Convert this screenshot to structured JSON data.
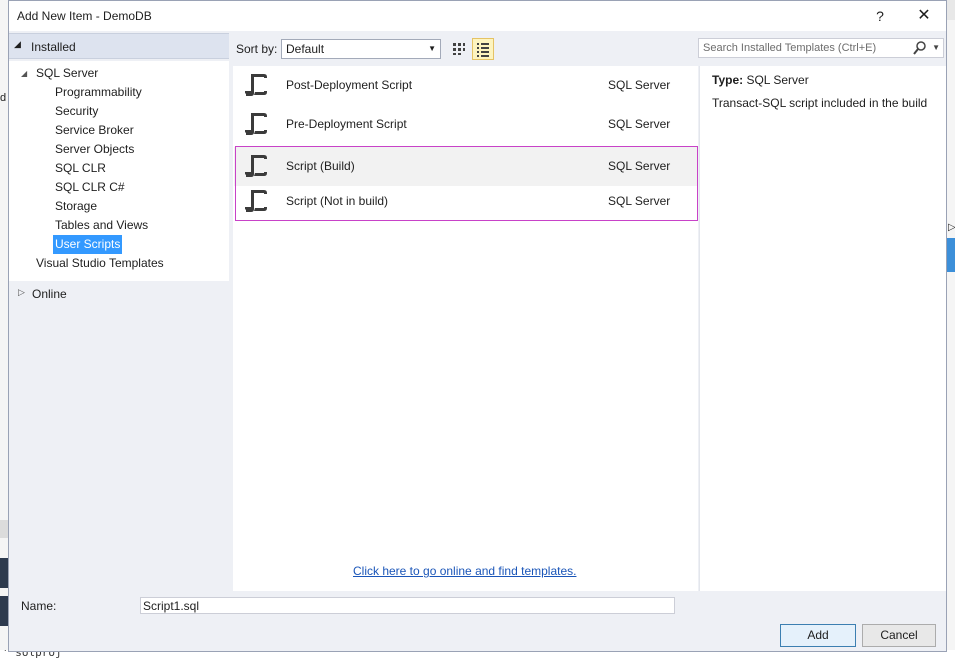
{
  "background": {
    "left_fragment_text": "d",
    "bottom_fragment_text": "' solproj'"
  },
  "dialog": {
    "title": "Add New Item - DemoDB",
    "help_glyph": "?",
    "close_glyph": "✕"
  },
  "left_pane": {
    "installed_label": "Installed",
    "tree": [
      {
        "label": "SQL Server",
        "level": 1,
        "expanded": true
      },
      {
        "label": "Programmability",
        "level": 2
      },
      {
        "label": "Security",
        "level": 2
      },
      {
        "label": "Service Broker",
        "level": 2
      },
      {
        "label": "Server Objects",
        "level": 2
      },
      {
        "label": "SQL CLR",
        "level": 2
      },
      {
        "label": "SQL CLR C#",
        "level": 2
      },
      {
        "label": "Storage",
        "level": 2
      },
      {
        "label": "Tables and Views",
        "level": 2
      },
      {
        "label": "User Scripts",
        "level": 2,
        "selected": true
      },
      {
        "label": "Visual Studio Templates",
        "level": 1
      }
    ],
    "online_label": "Online"
  },
  "toolbar": {
    "sort_label": "Sort by:",
    "sort_value": "Default",
    "search_placeholder": "Search Installed Templates (Ctrl+E)"
  },
  "templates": [
    {
      "name": "Post-Deployment Script",
      "category": "SQL Server"
    },
    {
      "name": "Pre-Deployment Script",
      "category": "SQL Server"
    },
    {
      "name": "Script (Build)",
      "category": "SQL Server",
      "selected": true
    },
    {
      "name": "Script (Not in build)",
      "category": "SQL Server"
    }
  ],
  "online_link": "Click here to go online and find templates.",
  "details": {
    "type_label": "Type:",
    "type_value": "SQL Server",
    "description": "Transact-SQL script included in the build"
  },
  "footer": {
    "name_label": "Name:",
    "name_value": "Script1.sql",
    "add_label": "Add",
    "cancel_label": "Cancel"
  },
  "colors": {
    "selection_blue": "#3399ff",
    "selection_outline": "#c842c8",
    "link": "#1a55b8"
  }
}
